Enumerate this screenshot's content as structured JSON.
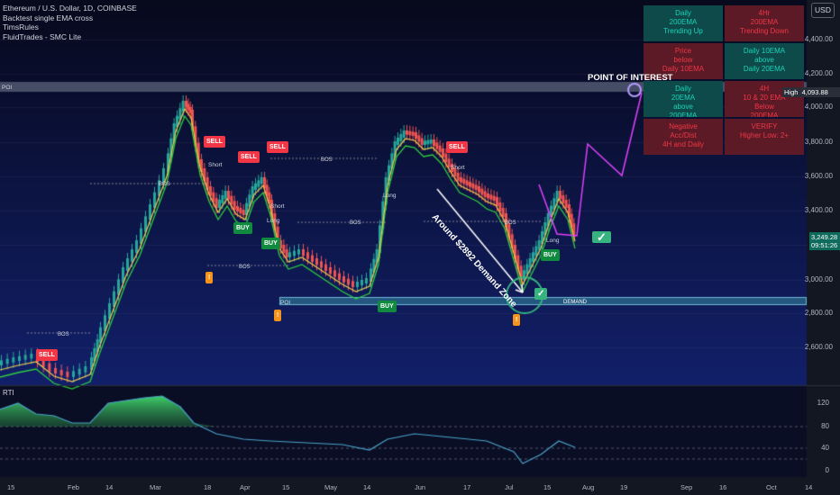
{
  "legend": {
    "symbol_line": "Ethereum / U.S. Dollar, 1D, COINBASE",
    "indicators": [
      "Backtest single EMA cross",
      "TimsRules",
      "FluidTrades - SMC Lite"
    ]
  },
  "currency_button": "USD",
  "price_axis": [
    "4,400.00",
    "4,200.00",
    "4,000.00",
    "3,800.00",
    "3,600.00",
    "3,400.00",
    "3,000.00",
    "2,800.00",
    "2,600.00"
  ],
  "rti_axis": [
    "120",
    "80",
    "40",
    "0"
  ],
  "time_axis": [
    "15",
    "Feb",
    "14",
    "Mar",
    "18",
    "Apr",
    "15",
    "May",
    "14",
    "Jun",
    "17",
    "Jul",
    "15",
    "Aug",
    "19",
    "Sep",
    "16",
    "Oct",
    "14"
  ],
  "price_labels": {
    "high_tag": "High",
    "high_value": "4,093.88",
    "last_price": "3,249.28",
    "countdown": "09:51:26"
  },
  "annotations": {
    "poi_title": "POINT OF INTEREST",
    "poi_left_label": "POI",
    "poi_zone_label": "POI",
    "demand_label": "DEMAND",
    "demand_zone_text": "Around $2892 Demand Zone",
    "bos": "BOS",
    "long": "Long",
    "short": "Short"
  },
  "signals": {
    "sell": "SELL",
    "buy": "BUY",
    "flag": "!"
  },
  "checkmark": "✓",
  "rti_label": "RTI",
  "table": {
    "cells": [
      {
        "text": "Daily\n200EMA\nTrending Up",
        "tone": "g"
      },
      {
        "text": "4Hr\n200EMA\nTrending Down",
        "tone": "r"
      },
      {
        "text": "Price\nbelow\nDaily 10EMA",
        "tone": "r"
      },
      {
        "text": "Daily 10EMA\nabove\nDaily 20EMA",
        "tone": "g"
      },
      {
        "text": "Daily\n20EMA\nabove\n200EMA",
        "tone": "g"
      },
      {
        "text": "4H\n10 & 20 EMA\nBelow\n200EMA",
        "tone": "r"
      },
      {
        "text": "Negative\nAcc/Dist\n4H and Daily",
        "tone": "r"
      },
      {
        "text": "VERIFY\nHigher Low: 2+",
        "tone": "r"
      }
    ]
  },
  "colors": {
    "background": "#0b1029",
    "bull": "#26a69a",
    "bear": "#ef5350",
    "ema_fast": "#f2c94c",
    "ema_slow": "#2ecc40",
    "projection": "#e040fb",
    "zone": "#2c6e8f"
  }
}
